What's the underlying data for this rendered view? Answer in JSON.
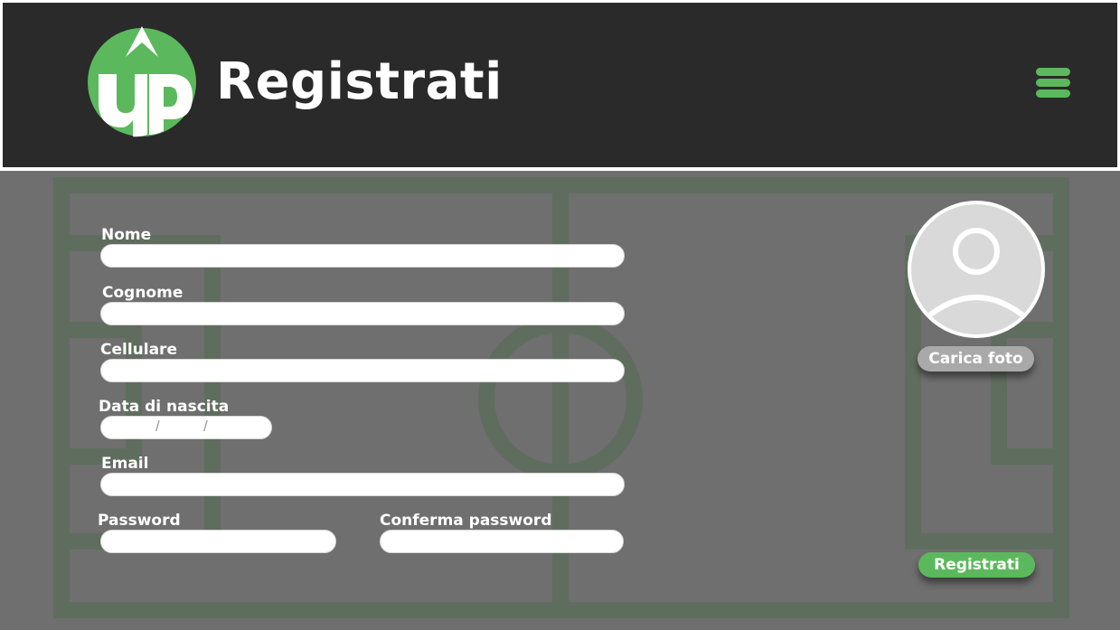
{
  "header": {
    "title": "Registrati",
    "logo_icon": "up-arrow-logo-icon",
    "menu_icon": "hamburger-menu-icon",
    "accent_color": "#5cb85c",
    "background_color": "#2a2a2a"
  },
  "form": {
    "nome_label": "Nome",
    "cognome_label": "Cognome",
    "cellulare_label": "Cellulare",
    "data_label": "Data di nascita",
    "date_separator": "/",
    "email_label": "Email",
    "password_label": "Password",
    "conferma_label": "Conferma password"
  },
  "profile": {
    "avatar_icon": "user-avatar-icon",
    "upload_label": "Carica foto"
  },
  "actions": {
    "submit_label": "Registrati"
  },
  "background": {
    "pattern": "football-field-icon",
    "color": "#6f6f6f"
  }
}
